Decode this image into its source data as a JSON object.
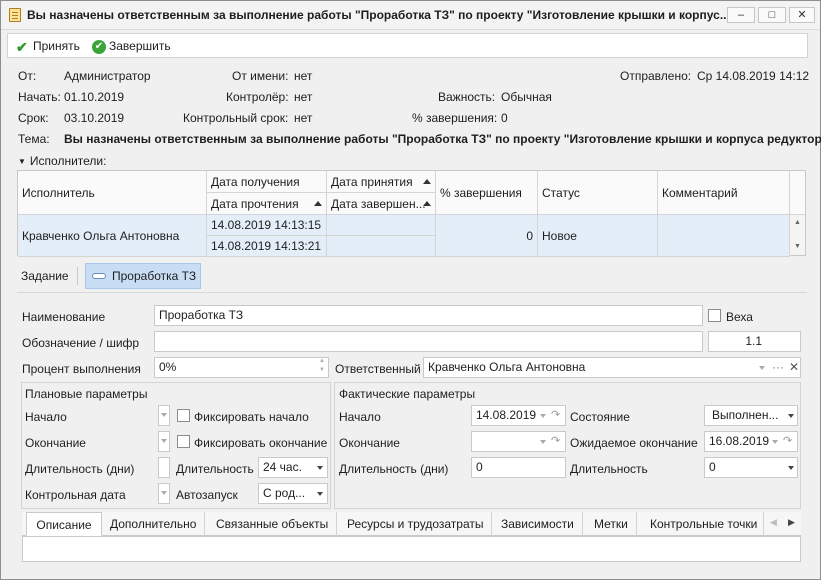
{
  "window": {
    "title": "Вы назначены ответственным за выполнение работы \"Проработка ТЗ\" по проекту \"Изготовление крышки и корпус...",
    "minimize": "–",
    "maximize": "□",
    "close": "✕"
  },
  "toolbar": {
    "accept_label": "Принять",
    "finish_label": "Завершить"
  },
  "header": {
    "from_label": "От:",
    "from_value": "Администратор",
    "on_behalf_label": "От имени:",
    "on_behalf_value": "нет",
    "sent_label": "Отправлено:",
    "sent_value": "Ср 14.08.2019 14:12",
    "start_label": "Начать:",
    "start_value": "01.10.2019",
    "controller_label": "Контролёр:",
    "controller_value": "нет",
    "importance_label": "Важность:",
    "importance_value": "Обычная",
    "due_label": "Срок:",
    "due_value": "03.10.2019",
    "control_due_label": "Контрольный срок:",
    "control_due_value": "нет",
    "percent_label": "% завершения:",
    "percent_value": "0",
    "subject_label": "Тема:",
    "subject_value": "Вы назначены ответственным за выполнение работы \"Проработка ТЗ\" по проекту \"Изготовление крышки и корпуса редуктора\"."
  },
  "executors": {
    "section_label": "Исполнители:",
    "columns": {
      "executor": "Исполнитель",
      "received": "Дата получения",
      "accepted": "Дата принятия",
      "read": "Дата прочтения",
      "completed": "Дата завершен...",
      "percent": "% завершения",
      "status": "Статус",
      "comment": "Комментарий"
    },
    "rows": [
      {
        "executor": "Кравченко Ольга Антоновна",
        "received": "14.08.2019 14:13:15",
        "accepted": "",
        "read": "14.08.2019 14:13:21",
        "completed": "",
        "percent": "0",
        "status": "Новое",
        "comment": ""
      }
    ]
  },
  "task": {
    "tab_label": "Задание",
    "tag_label": "Проработка ТЗ",
    "name_label": "Наименование",
    "name_value": "Проработка ТЗ",
    "milestone_label": "Веха",
    "code_label": "Обозначение / шифр",
    "code_value": "",
    "code_number": "1.1",
    "percent_label": "Процент выполнения",
    "percent_value": "0%",
    "responsible_label": "Ответственный",
    "responsible_value": "Кравченко Ольга Антоновна",
    "responsible_more": "···",
    "responsible_clear": "✕"
  },
  "planned": {
    "title": "Плановые параметры",
    "start_label": "Начало",
    "fix_start_label": "Фиксировать начало",
    "end_label": "Окончание",
    "fix_end_label": "Фиксировать окончание",
    "duration_days_label": "Длительность (дни)",
    "duration_label": "Длительность",
    "duration_value": "24 час.",
    "control_date_label": "Контрольная дата",
    "autostart_label": "Автозапуск",
    "autostart_value": "С род..."
  },
  "actual": {
    "title": "Фактические параметры",
    "start_label": "Начало",
    "start_value": "14.08.2019",
    "state_label": "Состояние",
    "state_value": "Выполнен...",
    "end_label": "Окончание",
    "end_value": "",
    "expected_end_label": "Ожидаемое окончание",
    "expected_end_value": "16.08.2019",
    "duration_days_label": "Длительность (дни)",
    "duration_days_value": "0",
    "duration_label": "Длительность",
    "duration_value": "0"
  },
  "bottom_tabs": {
    "items": [
      "Описание",
      "Дополнительно",
      "Связанные объекты",
      "Ресурсы и трудозатраты",
      "Зависимости",
      "Метки",
      "Контрольные точки"
    ],
    "active": "Описание",
    "scroll_left": "◀",
    "scroll_right": "▶"
  }
}
